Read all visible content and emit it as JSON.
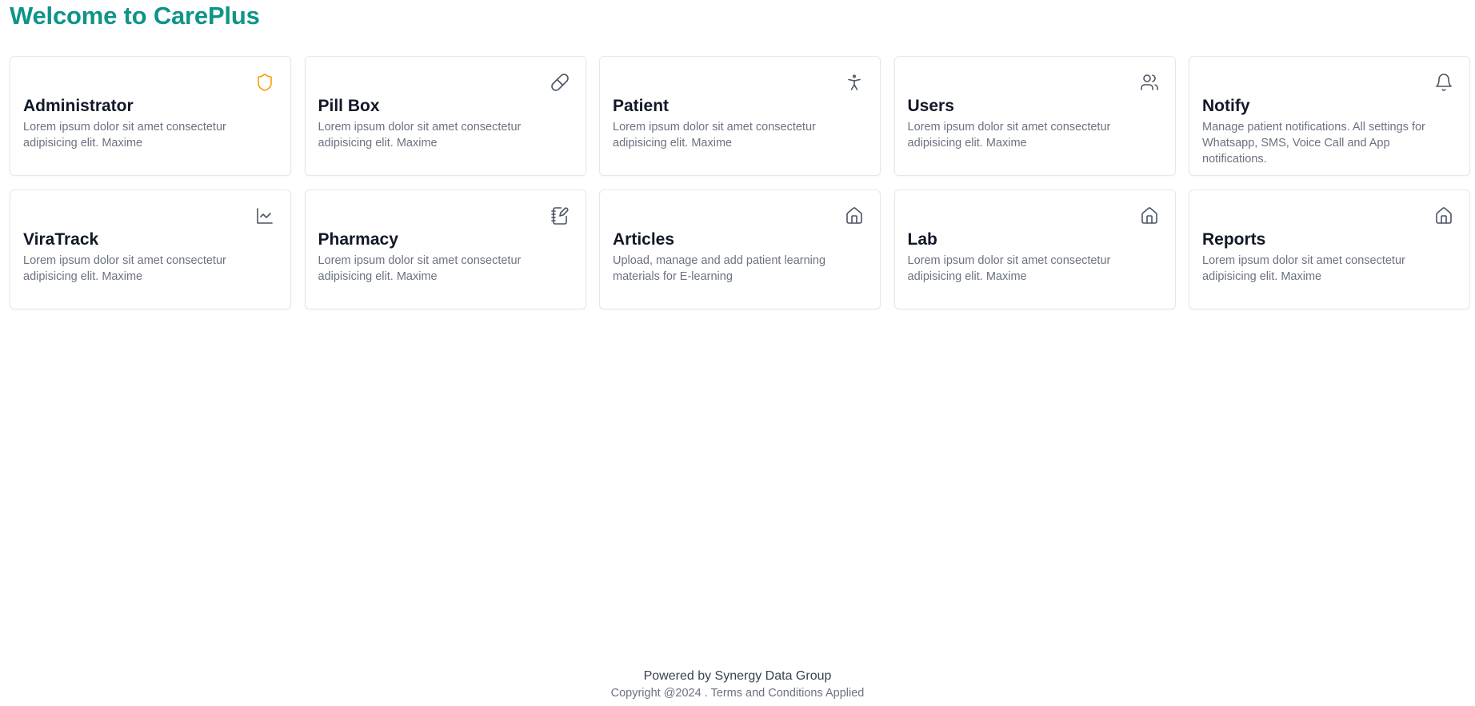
{
  "page": {
    "title": "Welcome to CarePlus"
  },
  "colors": {
    "brand": "#0f9488",
    "icon": "#4b5563",
    "admin_icon": "#f59e0b",
    "card_border": "#e5e7eb",
    "title_text": "#111827",
    "muted_text": "#6b7280"
  },
  "cards": [
    {
      "title": "Administrator",
      "description": "Lorem ipsum dolor sit amet consectetur adipisicing elit. Maxime",
      "icon": "shield-icon"
    },
    {
      "title": "Pill Box",
      "description": "Lorem ipsum dolor sit amet consectetur adipisicing elit. Maxime",
      "icon": "pill-icon"
    },
    {
      "title": "Patient",
      "description": "Lorem ipsum dolor sit amet consectetur adipisicing elit. Maxime",
      "icon": "accessibility-icon"
    },
    {
      "title": "Users",
      "description": "Lorem ipsum dolor sit amet consectetur adipisicing elit. Maxime",
      "icon": "users-icon"
    },
    {
      "title": "Notify",
      "description": "Manage patient notifications. All settings for Whatsapp, SMS, Voice Call and App notifications.",
      "icon": "bell-icon"
    },
    {
      "title": "ViraTrack",
      "description": "Lorem ipsum dolor sit amet consectetur adipisicing elit. Maxime",
      "icon": "line-chart-icon"
    },
    {
      "title": "Pharmacy",
      "description": "Lorem ipsum dolor sit amet consectetur adipisicing elit. Maxime",
      "icon": "notebook-pen-icon"
    },
    {
      "title": "Articles",
      "description": "Upload, manage and add patient learning materials for E-learning",
      "icon": "home-icon"
    },
    {
      "title": "Lab",
      "description": "Lorem ipsum dolor sit amet consectetur adipisicing elit. Maxime",
      "icon": "home-icon"
    },
    {
      "title": "Reports",
      "description": "Lorem ipsum dolor sit amet consectetur adipisicing elit. Maxime",
      "icon": "home-icon"
    }
  ],
  "footer": {
    "powered_by": "Powered by Synergy Data Group",
    "copyright": "Copyright @2024 . Terms and Conditions Applied"
  }
}
